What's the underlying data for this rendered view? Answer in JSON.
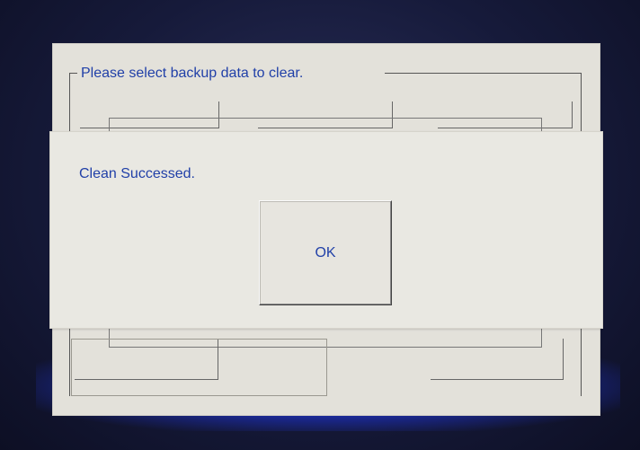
{
  "background_panel": {
    "group_title": "Please select backup data to clear."
  },
  "dialog": {
    "message": "Clean Successed.",
    "ok_label": "OK"
  },
  "colors": {
    "text_accent": "#2140a8",
    "panel_bg": "#e3e1da",
    "dialog_bg": "#e9e8e2",
    "screen_bg": "#161a3a"
  }
}
